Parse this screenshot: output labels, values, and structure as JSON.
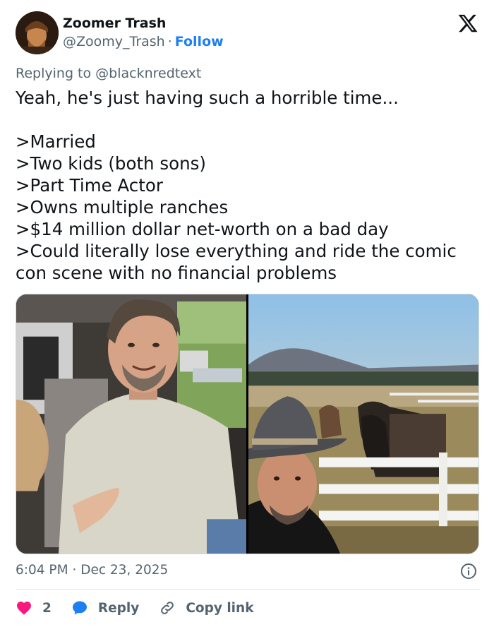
{
  "author": {
    "name": "Zoomer Trash",
    "handle": "@Zoomy_Trash",
    "separator": "·",
    "follow_label": "Follow"
  },
  "reply_context": {
    "prefix": "Replying to",
    "mention": "@blacknredtext"
  },
  "tweet": {
    "lines": [
      "Yeah, he's just having such a horrible time...",
      ">Married",
      ">Two kids (both sons)",
      ">Part Time Actor",
      ">Owns multiple ranches",
      ">$14 million dollar net-worth on a bad day",
      ">Could literally lose everything and ride the comic",
      "con scene with no financial problems"
    ]
  },
  "media": {
    "photos": [
      {
        "description_icon": "photo-man-in-car"
      },
      {
        "description_icon": "photo-man-in-cowboy-hat-with-horses"
      }
    ]
  },
  "meta": {
    "time": "6:04 PM",
    "separator": "·",
    "date": "Dec 23, 2025"
  },
  "actions": {
    "like_count": "2",
    "reply_label": "Reply",
    "copy_link_label": "Copy link"
  },
  "colors": {
    "accent": "#1d7ff0",
    "like": "#f91880",
    "secondary_text": "#536471",
    "primary_text": "#0f1419"
  },
  "icons": {
    "logo": "x-logo-icon",
    "info": "info-icon",
    "like": "heart-icon",
    "reply": "reply-bubble-icon",
    "copy": "link-icon"
  }
}
